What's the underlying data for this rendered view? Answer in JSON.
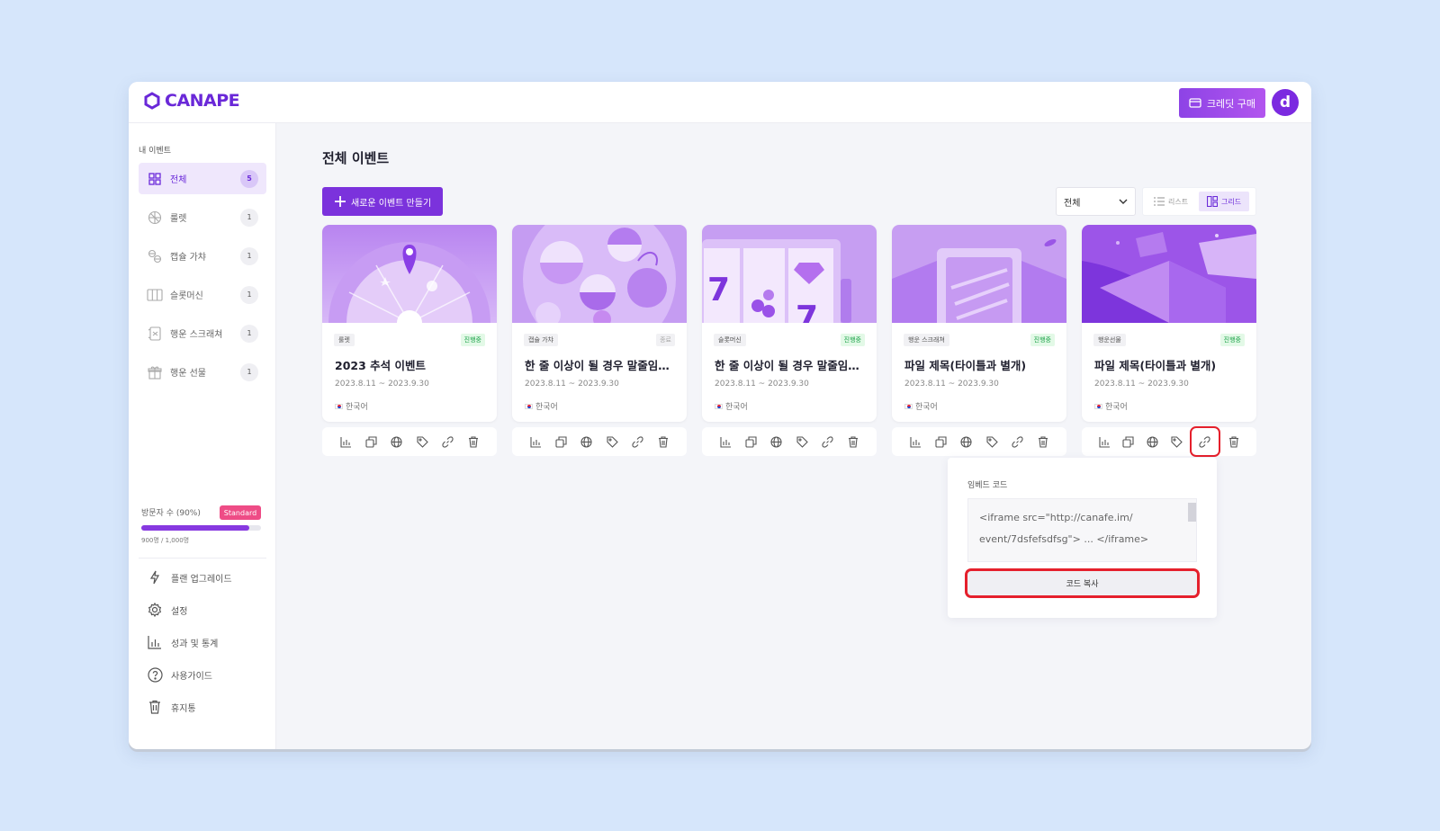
{
  "app": {
    "logo_text": "CANAPE",
    "credit_button": "크레딧 구매",
    "avatar_letter": "d"
  },
  "sidebar": {
    "heading": "내 이벤트",
    "items": [
      {
        "label": "전체",
        "count": "5",
        "icon": "grid-icon"
      },
      {
        "label": "룰렛",
        "count": "1",
        "icon": "roulette-icon"
      },
      {
        "label": "캡슐 가챠",
        "count": "1",
        "icon": "capsule-icon"
      },
      {
        "label": "슬롯머신",
        "count": "1",
        "icon": "slot-machine-icon"
      },
      {
        "label": "행운 스크래쳐",
        "count": "1",
        "icon": "scratcher-icon"
      },
      {
        "label": "행운 선물",
        "count": "1",
        "icon": "gift-icon"
      }
    ],
    "visitors": {
      "label": "방문자 수 (90%)",
      "plan": "Standard",
      "count_text": "900명 / 1,000명",
      "progress_fraction": 0.9
    },
    "bottom_items": [
      {
        "label": "플랜 업그레이드",
        "icon": "lightning-icon"
      },
      {
        "label": "설정",
        "icon": "gear-icon"
      },
      {
        "label": "성과 및 통계",
        "icon": "bar-chart-icon"
      },
      {
        "label": "사용가이드",
        "icon": "help-icon"
      },
      {
        "label": "휴지통",
        "icon": "trash-icon"
      }
    ]
  },
  "main": {
    "title": "전체 이벤트",
    "new_button": "새로운 이벤트 만들기",
    "filter_value": "전체",
    "view_list_label": "리스트",
    "view_grid_label": "그리드",
    "cards": [
      {
        "category": "룰렛",
        "status": "진행중",
        "title": "2023 추석 이벤트",
        "dates": "2023.8.11 ~ 2023.9.30",
        "language": "한국어"
      },
      {
        "category": "캡슐 가챠",
        "status": "종료",
        "title": "한 줄 이상이 될 경우 말줄임표...",
        "dates": "2023.8.11 ~ 2023.9.30",
        "language": "한국어"
      },
      {
        "category": "슬롯머신",
        "status": "진행중",
        "title": "한 줄 이상이 될 경우 말줄임표...",
        "dates": "2023.8.11 ~ 2023.9.30",
        "language": "한국어"
      },
      {
        "category": "행운 스크래쳐",
        "status": "진행중",
        "title": "파일 제목(타이틀과 별개)",
        "dates": "2023.8.11 ~ 2023.9.30",
        "language": "한국어"
      },
      {
        "category": "행운선물",
        "status": "진행중",
        "title": "파일 제목(타이틀과 별개)",
        "dates": "2023.8.11 ~ 2023.9.30",
        "language": "한국어"
      }
    ],
    "card_actions": [
      "stats-icon",
      "copy-icon",
      "globe-icon",
      "tag-icon",
      "link-icon",
      "trash-icon"
    ]
  },
  "embed": {
    "label": "임베드 코드",
    "code": "<iframe src=\"http://canafe.im/ event/7dsfefsdfsg\"> ... </iframe>",
    "copy_button": "코드 복사"
  },
  "colors": {
    "accent": "#7b32dc",
    "status_on": "#1da34a",
    "highlight": "#e5202c",
    "background": "#d6e6fb"
  }
}
